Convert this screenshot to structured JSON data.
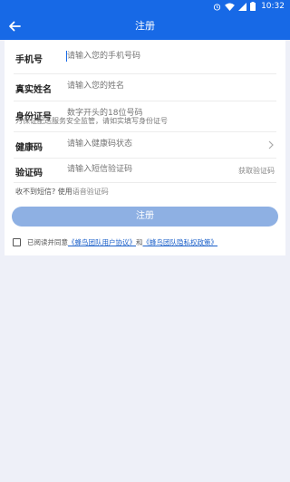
{
  "status_bar": {
    "time": "10:32",
    "icons": [
      "alarm-icon",
      "wifi-icon",
      "cellular-signal-icon",
      "battery-icon"
    ]
  },
  "app_bar": {
    "title": "注册",
    "back_icon": "arrow-left-icon"
  },
  "form": {
    "phone": {
      "label": "手机号",
      "placeholder": "请输入您的手机号码"
    },
    "name": {
      "label": "真实姓名",
      "placeholder": "请输入您的姓名"
    },
    "id_number": {
      "label": "身份证号",
      "placeholder": "数字开头的18位号码",
      "hint": "为保证配送服务安全监管，请如实填写身份证号"
    },
    "health_code": {
      "label": "健康码",
      "placeholder": "请输入健康码状态",
      "chevron_icon": "chevron-right-icon"
    },
    "sms_code": {
      "label": "验证码",
      "placeholder": "请输入短信验证码",
      "get_code": "获取验证码"
    },
    "voice_hint": {
      "prefix": "收不到短信? 使用",
      "link": "语音验证码"
    },
    "submit_label": "注册"
  },
  "agreement": {
    "prefix": "已阅读并同意",
    "user_agreement": "《蜂鸟团队用户协议》",
    "and": "和",
    "privacy_policy": "《蜂鸟团队隐私权政策》"
  },
  "colors": {
    "primary": "#1769e6",
    "button_disabled": "#8eb0e3",
    "link": "#1a5fc9",
    "background": "#eef0f8"
  }
}
